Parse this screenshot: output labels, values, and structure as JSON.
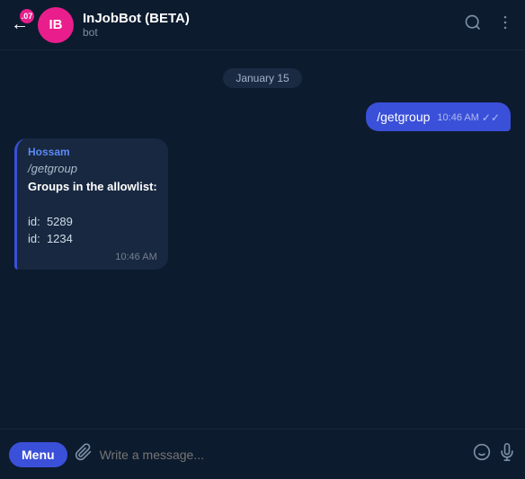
{
  "header": {
    "bot_name": "InJobBot (BETA)",
    "bot_sub": "bot",
    "avatar_initials": "IB",
    "badge_count": ".07",
    "back_icon": "←",
    "search_icon": "🔍",
    "more_icon": "⋮"
  },
  "chat": {
    "date_separator": "January 15",
    "messages": [
      {
        "type": "outgoing",
        "text": "/getgroup",
        "time": "10:46 AM",
        "ticks": "✓✓"
      },
      {
        "type": "incoming",
        "sender": "Hossam",
        "lines": [
          "/getgroup",
          "Groups in the allowlist:",
          "",
          "id:  5289",
          "id:  1234"
        ],
        "time": "10:46 AM"
      }
    ]
  },
  "input_bar": {
    "menu_label": "Menu",
    "placeholder": "Write a message...",
    "attach_icon": "📎",
    "emoji_icon": "😊",
    "mic_icon": "🎤"
  }
}
